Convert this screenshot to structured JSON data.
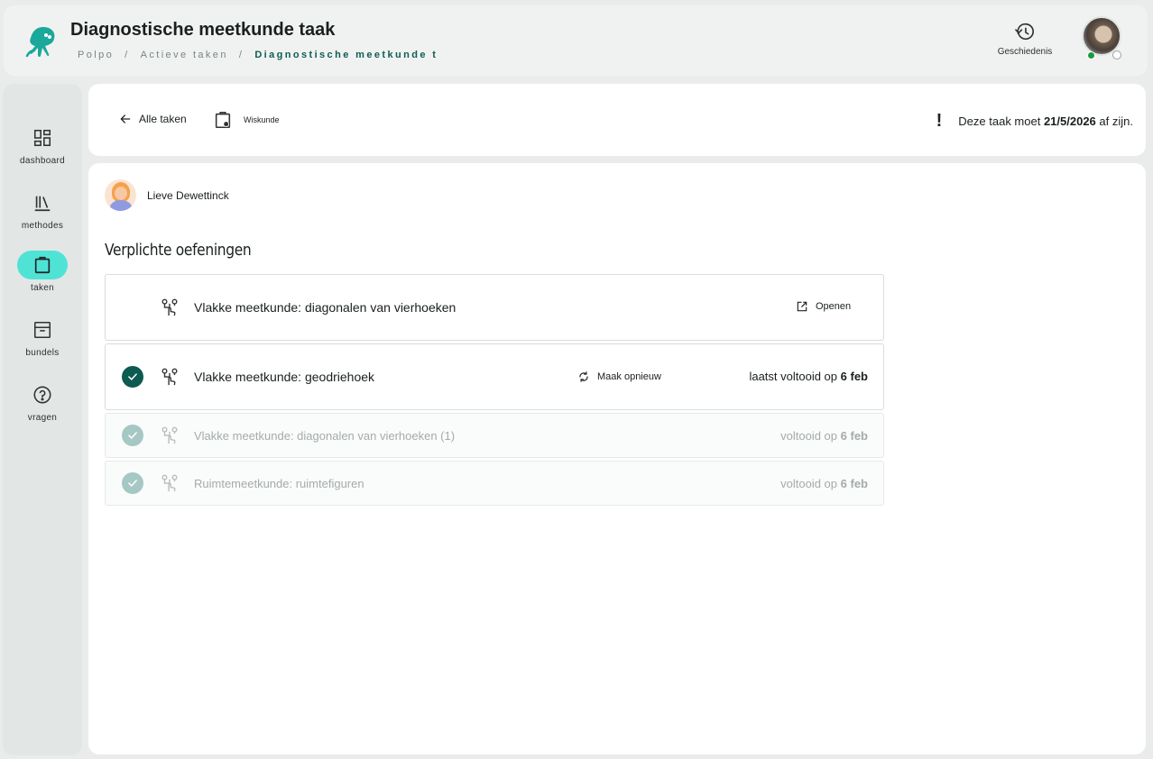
{
  "header": {
    "title": "Diagnostische meetkunde taak",
    "breadcrumb": [
      "Polpo",
      "Actieve taken",
      "Diagnostische meetkunde t"
    ],
    "history_label": "Geschiedenis",
    "logo_icon": "octopus-logo-icon",
    "accent_color": "#0f5d52"
  },
  "sidebar": {
    "items": [
      {
        "label": "dashboard",
        "icon": "dashboard-icon"
      },
      {
        "label": "methodes",
        "icon": "books-icon"
      },
      {
        "label": "taken",
        "icon": "clipboard-icon",
        "active": true
      },
      {
        "label": "bundels",
        "icon": "archive-icon"
      },
      {
        "label": "vragen",
        "icon": "help-icon"
      }
    ],
    "active_color": "#4fe3d6"
  },
  "taskbar": {
    "back_label": "Alle taken",
    "subject_label": "Wiskunde",
    "deadline_prefix": "Deze taak moet",
    "deadline_date": "21/5/2026",
    "deadline_suffix": "af zijn."
  },
  "content": {
    "teacher_name": "Lieve Dewettinck",
    "section_title": "Verplichte oefeningen",
    "exercises": [
      {
        "title": "Vlakke meetkunde: diagonalen van vierhoeken",
        "action": "Openen",
        "completed": false
      },
      {
        "title": "Vlakke meetkunde: geodriehoek",
        "action": "Maak opnieuw",
        "status_prefix": "laatst voltooid op",
        "status_date": "6 feb",
        "completed": true
      },
      {
        "title": "Vlakke meetkunde: diagonalen van vierhoeken (1)",
        "status_prefix": "voltooid op",
        "status_date": "6 feb",
        "completed": true,
        "faded": true
      },
      {
        "title": "Ruimtemeetkunde: ruimtefiguren",
        "status_prefix": "voltooid op",
        "status_date": "6 feb",
        "completed": true,
        "faded": true
      }
    ]
  }
}
